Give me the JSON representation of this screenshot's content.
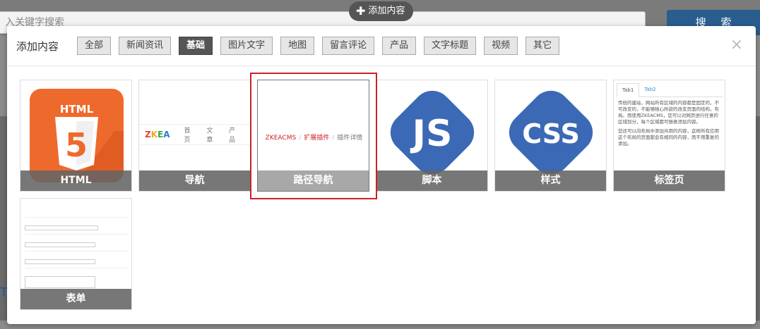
{
  "background": {
    "search_placeholder": "入关键字搜索",
    "search_button": "搜 索",
    "add_content_pill": "添加内容",
    "left_edge_char": "T"
  },
  "modal": {
    "title": "添加内容",
    "tabs": [
      {
        "label": "全部",
        "active": false
      },
      {
        "label": "新闻资讯",
        "active": false
      },
      {
        "label": "基础",
        "active": true
      },
      {
        "label": "图片文字",
        "active": false
      },
      {
        "label": "地图",
        "active": false
      },
      {
        "label": "留言评论",
        "active": false
      },
      {
        "label": "产品",
        "active": false
      },
      {
        "label": "文字标题",
        "active": false
      },
      {
        "label": "视频",
        "active": false
      },
      {
        "label": "其它",
        "active": false
      }
    ],
    "close": "×"
  },
  "widgets": [
    {
      "caption": "HTML",
      "icon": "html5-icon",
      "icon_text": "HTML"
    },
    {
      "caption": "导航",
      "preview": {
        "logo": "ZKEA",
        "items": [
          "首页",
          "文章",
          "产品"
        ]
      }
    },
    {
      "caption": "路径导航",
      "selected": true,
      "preview": {
        "crumbs": [
          "ZKEACMS",
          "扩展插件",
          "插件详情"
        ]
      }
    },
    {
      "caption": "脚本",
      "icon": "js-icon",
      "icon_text": "JS"
    },
    {
      "caption": "样式",
      "icon": "css-icon",
      "icon_text": "CSS"
    },
    {
      "caption": "标签页",
      "preview": {
        "tabs": [
          "Tab1",
          "Tab2"
        ],
        "para1": "传统的建站，网站所有区域的内容都是固定的，不可改变的，不能够随心所欲的改变页面的结构，布局。而使用ZKEACMS，您可以对网页进行任意的区域划分，每个区域都可随意添加内容。",
        "para2": "您还可以向布局中添加共用的内容，这样所有应用这个布局的页面都会有相同的内容，而不用重复的添加。"
      }
    },
    {
      "caption": "表单",
      "preview": {}
    }
  ],
  "colors": {
    "html5_orange": "#ee6a2c",
    "hex_blue": "#3b69b5",
    "selected_outline": "#cc2027",
    "zkea_z": "#e8403a",
    "zkea_k": "#f5a623",
    "zkea_e": "#3ba935",
    "zkea_a": "#2a7fd4"
  }
}
